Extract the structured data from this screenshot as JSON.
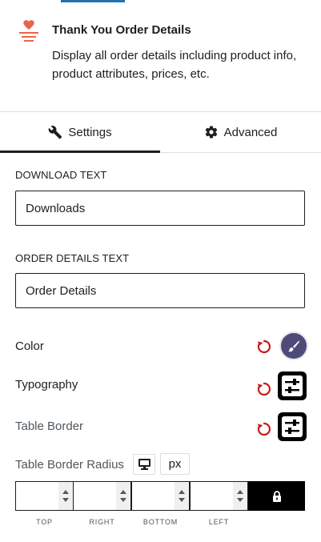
{
  "block": {
    "title": "Thank You Order Details",
    "description": "Display all order details including product info, product attributes, prices, etc.",
    "icon": "thank-you-heart-icon",
    "accent_color": "#e8664a"
  },
  "tabs": [
    {
      "label": "Settings",
      "icon": "wrench-icon",
      "active": true
    },
    {
      "label": "Advanced",
      "icon": "gear-icon",
      "active": false
    }
  ],
  "download": {
    "label": "DOWNLOAD TEXT",
    "value": "Downloads"
  },
  "order_details": {
    "label": "ORDER DETAILS TEXT",
    "value": "Order Details"
  },
  "controls": {
    "color": {
      "label": "Color",
      "swatch": "#4f4b78",
      "reset_color": "#cc1818"
    },
    "typography": {
      "label": "Typography"
    },
    "table_border": {
      "label": "Table Border"
    }
  },
  "table_border_radius": {
    "label": "Table Border Radius",
    "device_icon": "desktop-icon",
    "unit": "px",
    "sides": [
      "TOP",
      "RIGHT",
      "BOTTOM",
      "LEFT"
    ],
    "values": [
      "",
      "",
      "",
      ""
    ],
    "link_icon": "lock-icon"
  },
  "colors": {
    "active_tab_underline": "#1e1e1e",
    "top_strip": "#2271b1"
  }
}
